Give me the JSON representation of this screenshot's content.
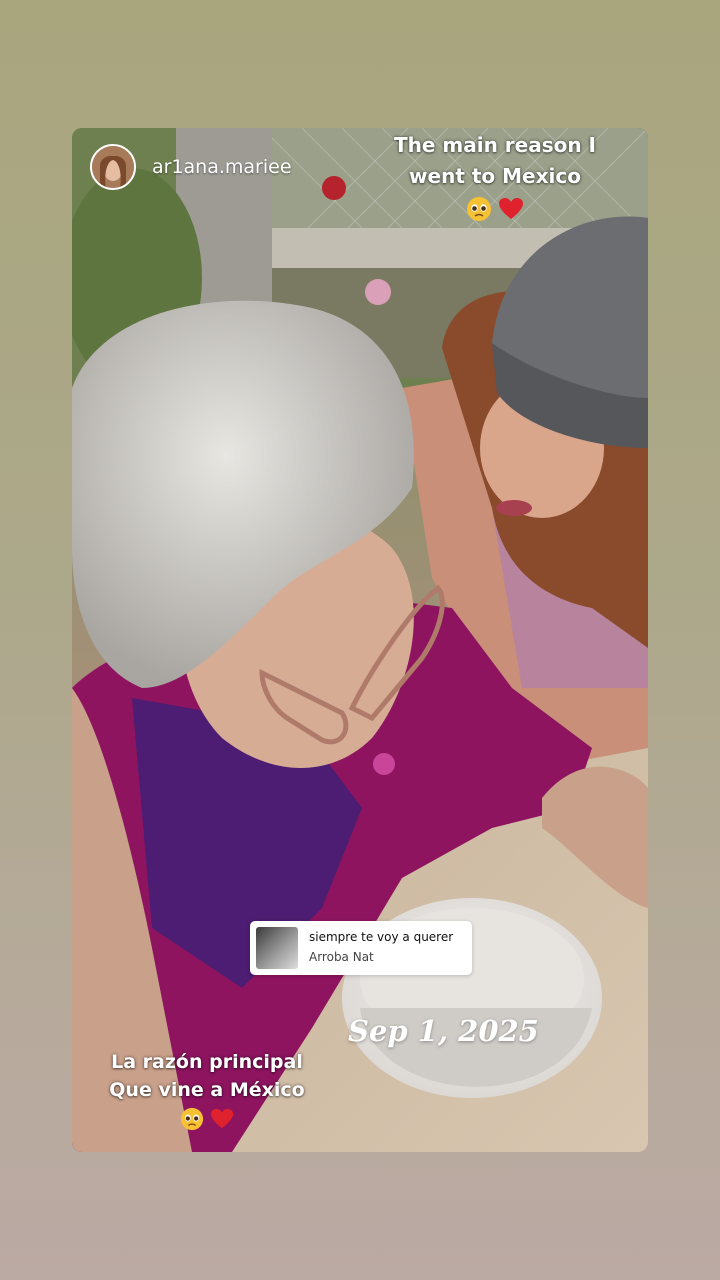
{
  "story": {
    "username": "ar1ana.mariee",
    "caption_top": [
      "The main reason I",
      "went to Mexico"
    ],
    "caption_bottom": [
      "La razón principal",
      "Que vine a México"
    ],
    "date_sticker": "Sep 1, 2025"
  },
  "music": {
    "title": "siempre te voy a querer",
    "artist": "Arroba Nat"
  },
  "icons": {
    "caption_emojis": [
      "pleading-face-icon",
      "red-heart-icon"
    ]
  },
  "colors": {
    "background_top": "#a9a67e",
    "background_bottom": "#bba9a3",
    "cardigan": "#8e1460",
    "cap": "#6c6d71"
  }
}
